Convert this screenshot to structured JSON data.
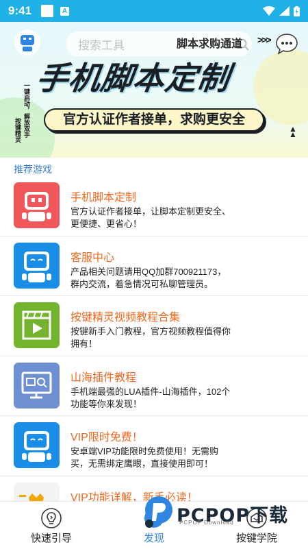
{
  "status_bar": {
    "time": "9:41"
  },
  "banner": {
    "search_placeholder": "搜索工具",
    "sub_title": "脚本求购通道",
    "arrows": ">>>",
    "title": "手机脚本定制",
    "pill_text": "官方认证作者接单，求购更安全",
    "vertical_text_1": "按键精灵",
    "vertical_text_2": "一键启动，解放双手",
    "page_indicator": {
      "count": 2,
      "active_index": 0
    }
  },
  "section": {
    "title": "推荐游戏"
  },
  "games": [
    {
      "title": "手机脚本定制",
      "desc": "官方认证作者接单，让脚本定制更安全、更便捷、更省心！",
      "icon": "robot-icon",
      "color": "#f0575a"
    },
    {
      "title": "客服中心",
      "desc": "产品相关问题请用QQ加群700921173，群内交流，着急情况可私聊管理员。",
      "icon": "robot-icon",
      "color": "#1a8ee6"
    },
    {
      "title": "按键精灵视频教程合集",
      "desc": "按键新手入门教程，官方视频教程值得你拥有！",
      "icon": "video-icon",
      "color": "#74b32e"
    },
    {
      "title": "山海插件教程",
      "desc": "手机端最强的LUA插件-山海插件，102个功能等你来发现！",
      "icon": "plugin-monitor-icon",
      "color": "#6e8fd2"
    },
    {
      "title": "VIP限时免费！",
      "desc": "安卓端VIP功能限时免费使用！无需购买，无需绑定鹰眼，直接使用即可！",
      "icon": "robot-icon",
      "color": "#1a8ee6"
    },
    {
      "title": "VIP功能详解，新手必读！",
      "desc": "",
      "icon": "vip-crown-icon",
      "color": "#f3f3f3"
    }
  ],
  "bottom_nav": [
    {
      "label": "快速引导",
      "icon": "lightbulb-icon",
      "active": false
    },
    {
      "label": "发现",
      "icon": "discover-icon",
      "active": true
    },
    {
      "label": "按键学院",
      "icon": "academy-icon",
      "active": false
    }
  ],
  "watermark": {
    "text": "PCPOP下载",
    "sub": "PCPOP Download"
  },
  "colors": {
    "accent": "#2f86e1",
    "item_title": "#f0681e",
    "status_bar": "#20b2e6"
  }
}
